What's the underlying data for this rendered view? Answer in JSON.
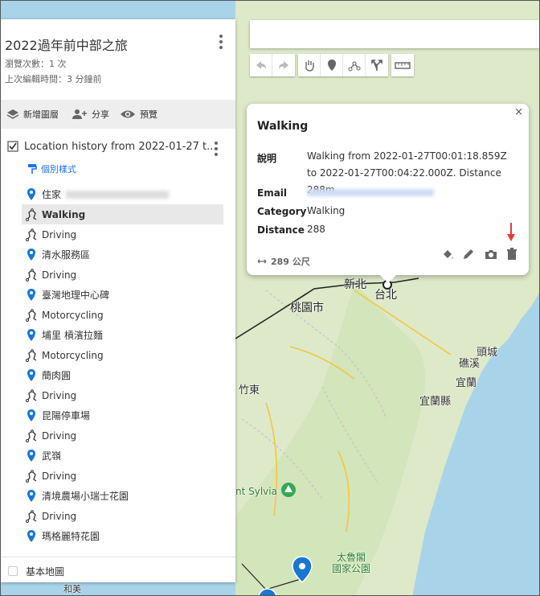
{
  "map": {
    "labels": {
      "xinbei": "新北",
      "taibei": "台北",
      "taoyuan": "桃園市",
      "toucheng": "頭城",
      "jiaoxi": "礁溪",
      "yilan": "宜蘭",
      "yilan_county": "宜蘭縣",
      "zhudong": "竹東",
      "sylvia": "nt Sylvia",
      "taroko": "太魯閣",
      "park": "國家公園",
      "hemei": "和美"
    }
  },
  "sidebar": {
    "map_title": "2022過年前中部之旅",
    "views": "瀏覽次數：1 次",
    "last_edit": "上次編輯時間：3 分鐘前",
    "actions": {
      "add_layer": "新增圖層",
      "share": "分享",
      "preview": "預覽"
    },
    "layer": {
      "name": "Location history from 2022-01-27 t...",
      "style_link": "個別樣式"
    },
    "items": [
      {
        "label": "住家",
        "type": "pin"
      },
      {
        "label": "Walking",
        "type": "path"
      },
      {
        "label": "Driving",
        "type": "path"
      },
      {
        "label": "清水服務區",
        "type": "pin"
      },
      {
        "label": "Driving",
        "type": "path"
      },
      {
        "label": "臺灣地理中心碑",
        "type": "pin"
      },
      {
        "label": "Motorcycling",
        "type": "path"
      },
      {
        "label": "埔里 槓濱拉麵",
        "type": "pin"
      },
      {
        "label": "Motorcycling",
        "type": "path"
      },
      {
        "label": "蕳肉圓",
        "type": "pin"
      },
      {
        "label": "Driving",
        "type": "path"
      },
      {
        "label": "昆陽停車場",
        "type": "pin"
      },
      {
        "label": "Driving",
        "type": "path"
      },
      {
        "label": "武嶺",
        "type": "pin"
      },
      {
        "label": "Driving",
        "type": "path"
      },
      {
        "label": "清境農場小瑞士花園",
        "type": "pin"
      },
      {
        "label": "Driving",
        "type": "path"
      },
      {
        "label": "瑪格麗特花園",
        "type": "pin"
      }
    ],
    "basemap": "基本地圖"
  },
  "popup": {
    "close": "×",
    "title": "Walking",
    "props": {
      "desc_key": "說明",
      "desc_val": "Walking from 2022-01-27T00:01:18.859Z to 2022-01-27T00:04:22.000Z. Distance 288m",
      "email_key": "Email",
      "category_key": "Category",
      "category_val": "Walking",
      "distance_key": "Distance",
      "distance_val": "288"
    },
    "measure": "289 公尺"
  },
  "colors": {
    "pin": "#1976d2",
    "link": "#1a73e8",
    "annotation": "#e53935",
    "sea": "#a9d3e9",
    "land": "#dbe9c6"
  },
  "icons": {
    "toolbar": [
      "undo-icon",
      "redo-icon",
      "hand-icon",
      "marker-icon",
      "line-icon",
      "directions-icon",
      "ruler-icon"
    ],
    "popup_actions": [
      "paint-bucket-icon",
      "pencil-icon",
      "camera-icon",
      "trash-icon"
    ]
  }
}
